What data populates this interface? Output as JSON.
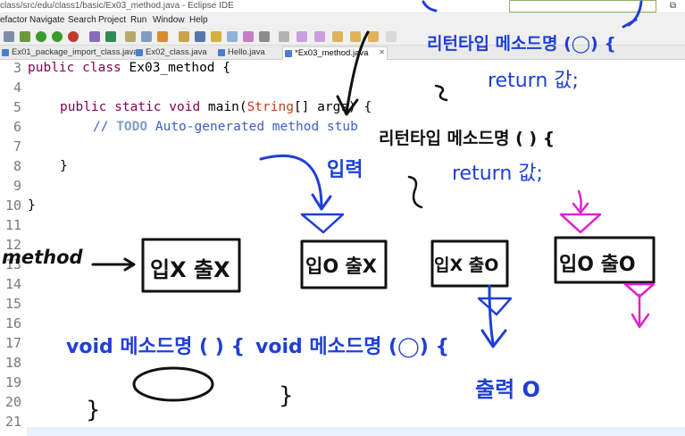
{
  "window": {
    "title": "class/src/edu/class1/basic/Ex03_method.java - Eclipse IDE",
    "restore_glyph": "⧉"
  },
  "menu": [
    "efactor",
    "Navigate",
    "Search",
    "Project",
    "Run",
    "Window",
    "Help"
  ],
  "tabs": [
    {
      "label": "Ex01_package_import_class.java",
      "active": false
    },
    {
      "label": "Ex02_class.java",
      "active": false
    },
    {
      "label": "Hello.java",
      "active": false
    },
    {
      "label": "*Ex03_method.java",
      "active": true
    }
  ],
  "tab_close_glyph": "✕",
  "code": {
    "line_numbers": [
      "3",
      "4",
      "5",
      "6",
      "7",
      "8",
      "9",
      "10",
      "11",
      "12",
      "13",
      "14",
      "15",
      "16",
      "17",
      "18",
      "19",
      "20",
      "21"
    ],
    "line3": {
      "kw1": "public",
      "kw2": "class",
      "rest": " Ex03_method {"
    },
    "line5": {
      "kw1": "public",
      "kw2": "static",
      "kw3": "void",
      "rest1": " main(",
      "type": "String",
      "rest2": "[] args) {"
    },
    "line6": {
      "comment_prefix": "// ",
      "todo": "TODO",
      "comment_rest": " Auto-generated method stub"
    },
    "line8": "}",
    "line10": "}"
  },
  "annotations": {
    "top_right_signature": "리턴타입 메소드명 (◯) {",
    "top_return": "return 값;",
    "mid_signature": "리턴타입 메소드명 ( ) {",
    "mid_return": "return 값;",
    "input_label": "입력",
    "method_label": "method",
    "box1": "입X 출X",
    "box2": "입O 출X",
    "box3": "입X 출O",
    "box4": "입O 출O",
    "void_sig1": "void 메소드명 ( ) {",
    "void_sig2": "void 메소드명 (◯) {",
    "output_label": "출력 O",
    "brace_close": "}"
  },
  "colors": {
    "ink_black": "#111111",
    "ink_blue": "#1f3fd6",
    "ink_magenta": "#e020d0"
  }
}
